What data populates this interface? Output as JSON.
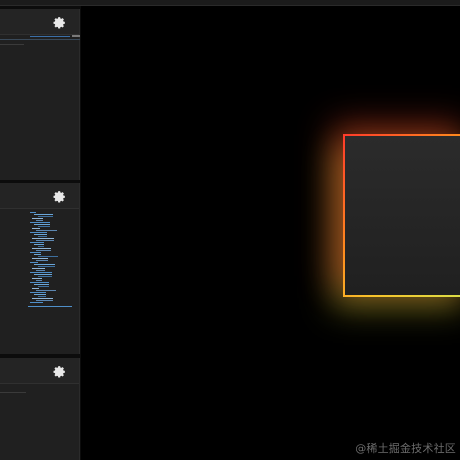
{
  "topbar": {},
  "sidebar": {
    "panels": [
      {
        "icon": "gear-icon"
      },
      {
        "icon": "gear-icon"
      },
      {
        "icon": "gear-icon"
      }
    ]
  },
  "stage": {
    "glow_colors": [
      "#ff3b2a",
      "#ff8a1e",
      "#f7c32b",
      "#d8e04a"
    ]
  },
  "watermark": "@稀土掘金技术社区"
}
